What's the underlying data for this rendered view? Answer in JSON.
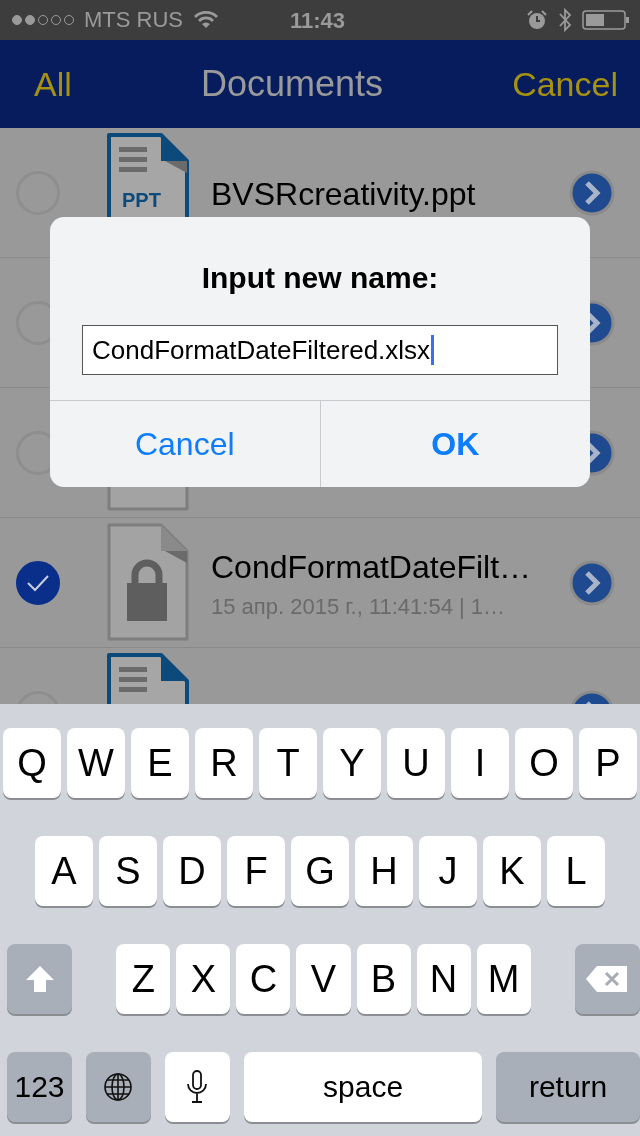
{
  "status_bar": {
    "signal_dots": [
      {
        "filled": true
      },
      {
        "filled": true
      },
      {
        "filled": false
      },
      {
        "filled": false
      },
      {
        "filled": false
      }
    ],
    "carrier": "MTS RUS",
    "time": "11:43"
  },
  "nav_bar": {
    "left": "All",
    "title": "Documents",
    "right": "Cancel"
  },
  "documents": [
    {
      "selected": false,
      "kind": "ppt",
      "icon_label": "PPT",
      "name": "BVSRcreativity.ppt"
    },
    {
      "selected": false
    },
    {
      "selected": false,
      "kind": "plain"
    },
    {
      "selected": true,
      "kind": "locked",
      "name": "CondFormatDateFilt…",
      "details": "15 апр. 2015 г., 11:41:54 | 1…"
    },
    {
      "selected": false,
      "kind": "doc"
    }
  ],
  "dialog": {
    "title": "Input new name:",
    "value": "CondFormatDateFiltered.xlsx",
    "buttons": [
      {
        "label": "Cancel",
        "kind": "cancel"
      },
      {
        "label": "OK",
        "kind": "default"
      }
    ]
  },
  "keyboard": {
    "rows": [
      {
        "keys": [
          {
            "kind": "letter",
            "label": "Q"
          },
          {
            "kind": "letter",
            "label": "W"
          },
          {
            "kind": "letter",
            "label": "E"
          },
          {
            "kind": "letter",
            "label": "R"
          },
          {
            "kind": "letter",
            "label": "T"
          },
          {
            "kind": "letter",
            "label": "Y"
          },
          {
            "kind": "letter",
            "label": "U"
          },
          {
            "kind": "letter",
            "label": "I"
          },
          {
            "kind": "letter",
            "label": "O"
          },
          {
            "kind": "letter",
            "label": "P"
          }
        ]
      },
      {
        "keys": [
          {
            "kind": "letter",
            "label": "A"
          },
          {
            "kind": "letter",
            "label": "S"
          },
          {
            "kind": "letter",
            "label": "D"
          },
          {
            "kind": "letter",
            "label": "F"
          },
          {
            "kind": "letter",
            "label": "G"
          },
          {
            "kind": "letter",
            "label": "H"
          },
          {
            "kind": "letter",
            "label": "J"
          },
          {
            "kind": "letter",
            "label": "K"
          },
          {
            "kind": "letter",
            "label": "L"
          }
        ]
      },
      {
        "keys": [
          {
            "kind": "shift"
          },
          {
            "kind": "letter",
            "label": "Z"
          },
          {
            "kind": "letter",
            "label": "X"
          },
          {
            "kind": "letter",
            "label": "C"
          },
          {
            "kind": "letter",
            "label": "V"
          },
          {
            "kind": "letter",
            "label": "B"
          },
          {
            "kind": "letter",
            "label": "N"
          },
          {
            "kind": "letter",
            "label": "M"
          },
          {
            "kind": "backspace"
          }
        ]
      },
      {
        "keys": [
          {
            "kind": "mode",
            "label": "123"
          },
          {
            "kind": "globe"
          },
          {
            "kind": "mic"
          },
          {
            "kind": "space",
            "label": "space"
          },
          {
            "kind": "return",
            "label": "return"
          }
        ]
      }
    ]
  }
}
